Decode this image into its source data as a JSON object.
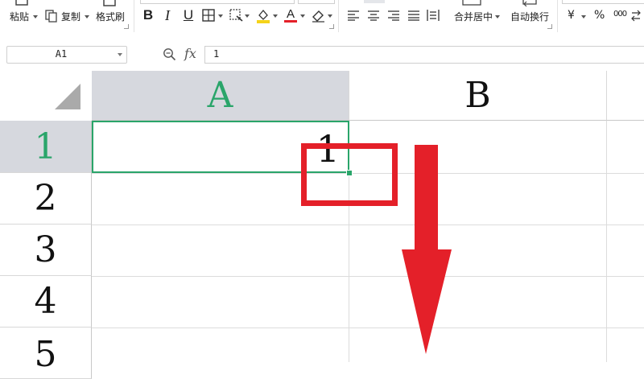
{
  "ribbon": {
    "paste_label": "粘贴",
    "copy_label": "复制",
    "format_painter_label": "格式刷",
    "bold_icon": "B",
    "italic_icon": "I",
    "underline_icon": "U",
    "merge_center_label": "合并居中",
    "wrap_text_label": "自动换行",
    "currency_symbol": "¥",
    "percent_symbol": "%",
    "thousands_symbol": "000",
    "font_color_icon": "A",
    "accent_font_color": "#e42029",
    "fill_color": "#f5d31a"
  },
  "formula_bar": {
    "name_box_value": "A1",
    "fx_label": "fx",
    "formula_value": "1"
  },
  "sheet": {
    "columns": [
      "A",
      "B"
    ],
    "rows": [
      "1",
      "2",
      "3",
      "4",
      "5"
    ],
    "active_cell": "A1",
    "cell_A1_value": "1",
    "selection_color": "#2aa56a",
    "header_highlight_color": "#d6d8de"
  },
  "annotations": {
    "highlight_color": "#e42029"
  }
}
